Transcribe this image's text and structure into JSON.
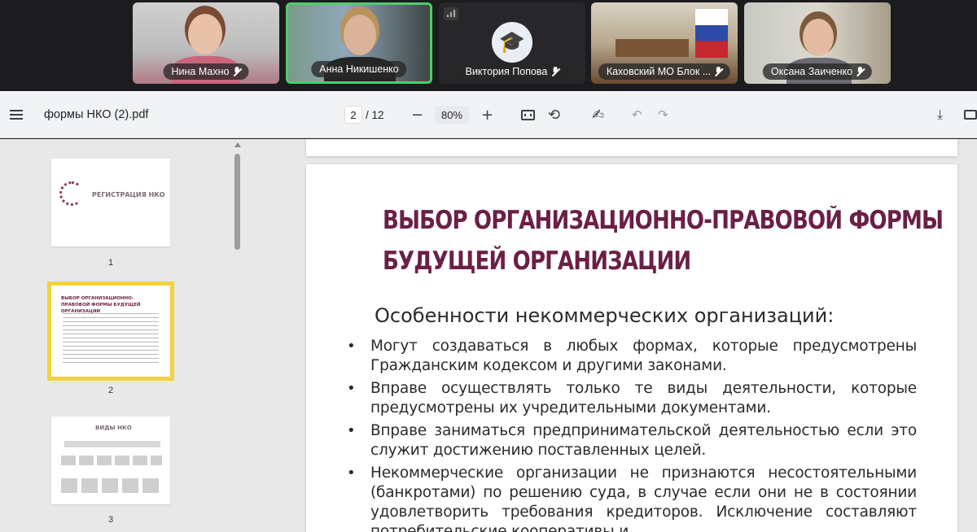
{
  "participants": [
    {
      "name": "Нина Махно",
      "muted": true
    },
    {
      "name": "Анна Никишенко",
      "muted": false
    },
    {
      "name": "Виктория Попова",
      "muted": true
    },
    {
      "name": "Каховский МО Блок ...",
      "muted": true
    },
    {
      "name": "Оксана Заиченко",
      "muted": true
    }
  ],
  "toolbar": {
    "file_name": "формы НКО (2).pdf",
    "current_page": "2",
    "total_pages": "/ 12",
    "zoom": "80%",
    "icons": [
      "menu-icon",
      "zoom-out-icon",
      "zoom-in-icon",
      "fit-page-icon",
      "rotate-icon",
      "draw-icon",
      "undo-icon",
      "redo-icon",
      "download-icon",
      "print-icon"
    ]
  },
  "thumbnails": [
    {
      "number": "1",
      "text": "РЕГИСТРАЦИЯ НКО"
    },
    {
      "number": "2",
      "text": "ВЫБОР ОРГАНИЗАЦИОННО-ПРАВОВОЙ ФОРМЫ БУДУЩЕЙ ОРГАНИЗАЦИИ"
    },
    {
      "number": "3",
      "text": "ВИДЫ НКО"
    }
  ],
  "slide": {
    "title_line1": "Выбор организационно-правовой формы",
    "title_line2": "будущей организации",
    "subtitle": "Особенности некоммерческих организаций:",
    "bullets": [
      "Могут создаваться в любых формах, которые предусмотрены Гражданским кодексом и другими законами.",
      "Вправе осуществлять только те виды деятельности, которые предусмотрены их учредительными документами.",
      "Вправе заниматься предпринимательской деятельностью если это служит достижению поставленных целей.",
      "Некоммерческие организации не признаются несостоятельными (банкротами) по решению суда, в случае если они не в состоянии удовлетворить требования кредиторов. Исключение составляют потребительские кооперативы и"
    ]
  },
  "colors": {
    "title": "#6b1f47",
    "active_speaker": "#4ccf6b",
    "selected_thumb": "#f2d33b"
  }
}
